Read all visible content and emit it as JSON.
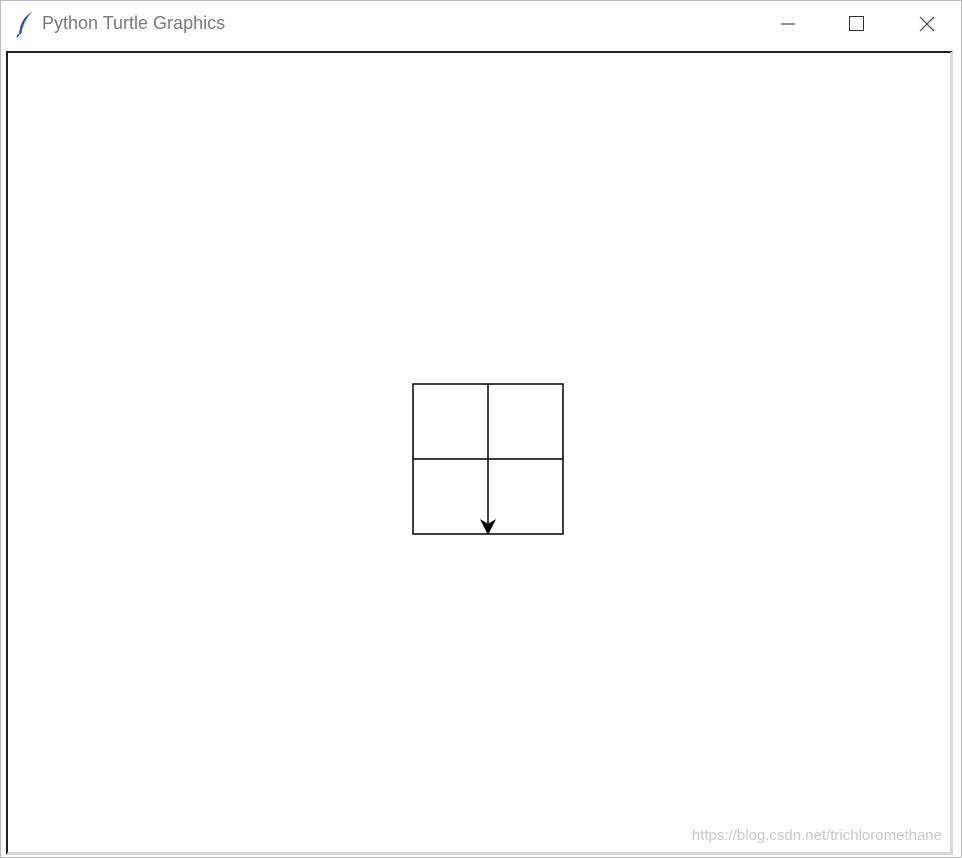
{
  "window": {
    "title": "Python Turtle Graphics",
    "app_icon": "feather-icon",
    "controls": {
      "minimize": "minimize-icon",
      "maximize": "maximize-icon",
      "close": "close-icon"
    }
  },
  "canvas": {
    "background": "#ffffff",
    "pen_color": "#000000",
    "turtle_shape": "arrow",
    "turtle_heading": "down"
  },
  "watermark": "https://blog.csdn.net/trichloromethane"
}
